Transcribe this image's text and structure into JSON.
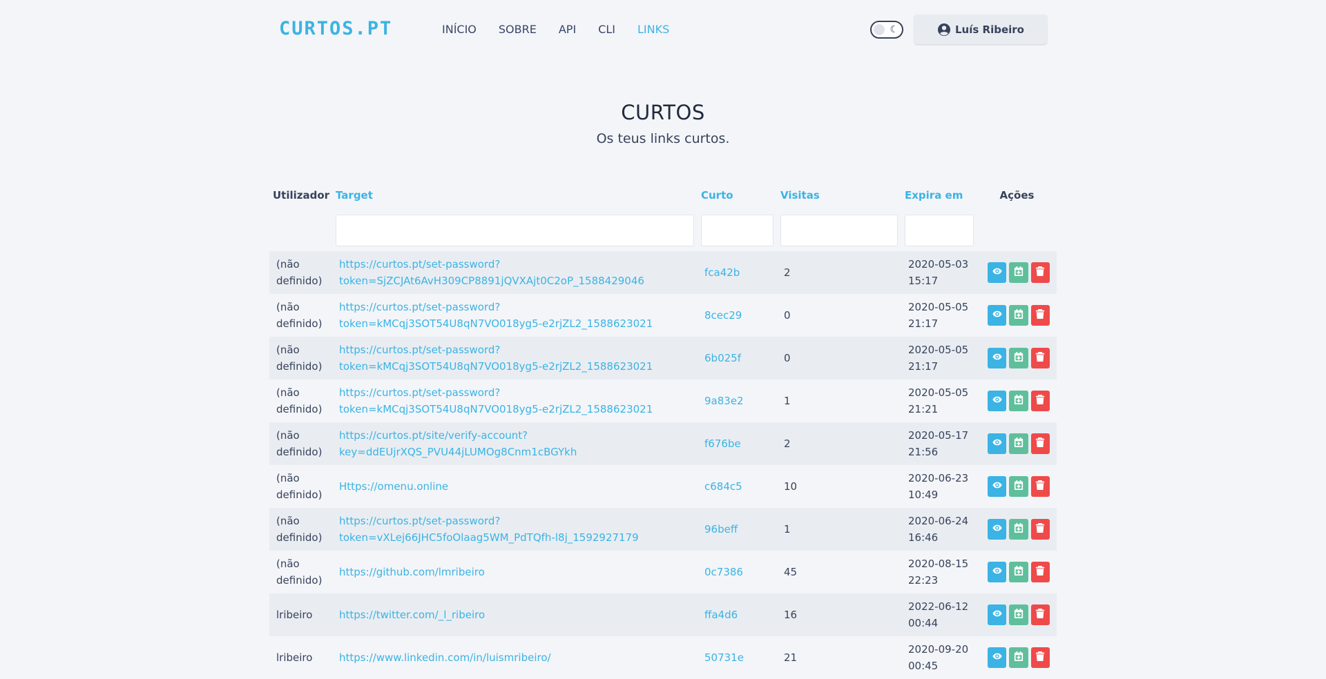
{
  "header": {
    "logo": "CURTOS.PT",
    "nav": [
      "INÍCIO",
      "SOBRE",
      "API",
      "CLI",
      "LINKS"
    ],
    "active_nav": "LINKS",
    "user_name": "Luís Ribeiro"
  },
  "page": {
    "title": "CURTOS",
    "subtitle": "Os teus links curtos."
  },
  "table": {
    "headers": [
      "Utilizador",
      "Target",
      "Curto",
      "Visitas",
      "Expira em",
      "Ações"
    ],
    "rows": [
      {
        "user": "(não definido)",
        "target": "https://curtos.pt/set-password?token=SjZCJAt6AvH309CP8891jQVXAjt0C2oP_1588429046",
        "short": "fca42b",
        "visits": "2",
        "expires": "2020-05-03 15:17"
      },
      {
        "user": "(não definido)",
        "target": "https://curtos.pt/set-password?token=kMCqj3SOT54U8qN7VO018yg5-e2rjZL2_1588623021",
        "short": "8cec29",
        "visits": "0",
        "expires": "2020-05-05 21:17"
      },
      {
        "user": "(não definido)",
        "target": "https://curtos.pt/set-password?token=kMCqj3SOT54U8qN7VO018yg5-e2rjZL2_1588623021",
        "short": "6b025f",
        "visits": "0",
        "expires": "2020-05-05 21:17"
      },
      {
        "user": "(não definido)",
        "target": "https://curtos.pt/set-password?token=kMCqj3SOT54U8qN7VO018yg5-e2rjZL2_1588623021",
        "short": "9a83e2",
        "visits": "1",
        "expires": "2020-05-05 21:21"
      },
      {
        "user": "(não definido)",
        "target": "https://curtos.pt/site/verify-account?key=ddEUjrXQS_PVU44jLUMOg8Cnm1cBGYkh",
        "short": "f676be",
        "visits": "2",
        "expires": "2020-05-17 21:56"
      },
      {
        "user": "(não definido)",
        "target": "Https://omenu.online",
        "short": "c684c5",
        "visits": "10",
        "expires": "2020-06-23 10:49"
      },
      {
        "user": "(não definido)",
        "target": "https://curtos.pt/set-password?token=vXLej66JHC5foOlaag5WM_PdTQfh-l8j_1592927179",
        "short": "96beff",
        "visits": "1",
        "expires": "2020-06-24 16:46"
      },
      {
        "user": "(não definido)",
        "target": "https://github.com/lmribeiro",
        "short": "0c7386",
        "visits": "45",
        "expires": "2020-08-15 22:23"
      },
      {
        "user": "lribeiro",
        "target": "https://twitter.com/_l_ribeiro",
        "short": "ffa4d6",
        "visits": "16",
        "expires": "2022-06-12 00:44"
      },
      {
        "user": "lribeiro",
        "target": "https://www.linkedin.com/in/luismribeiro/",
        "short": "50731e",
        "visits": "21",
        "expires": "2020-09-20 00:45"
      }
    ]
  },
  "icons": {
    "view": "eye-icon",
    "extend": "calendar-plus-icon",
    "delete": "trash-icon",
    "user": "user-circle-icon",
    "theme": "moon-icon"
  },
  "colors": {
    "accent": "#3bb3e4",
    "extend": "#5fbf9b",
    "delete": "#ef4a4a"
  }
}
